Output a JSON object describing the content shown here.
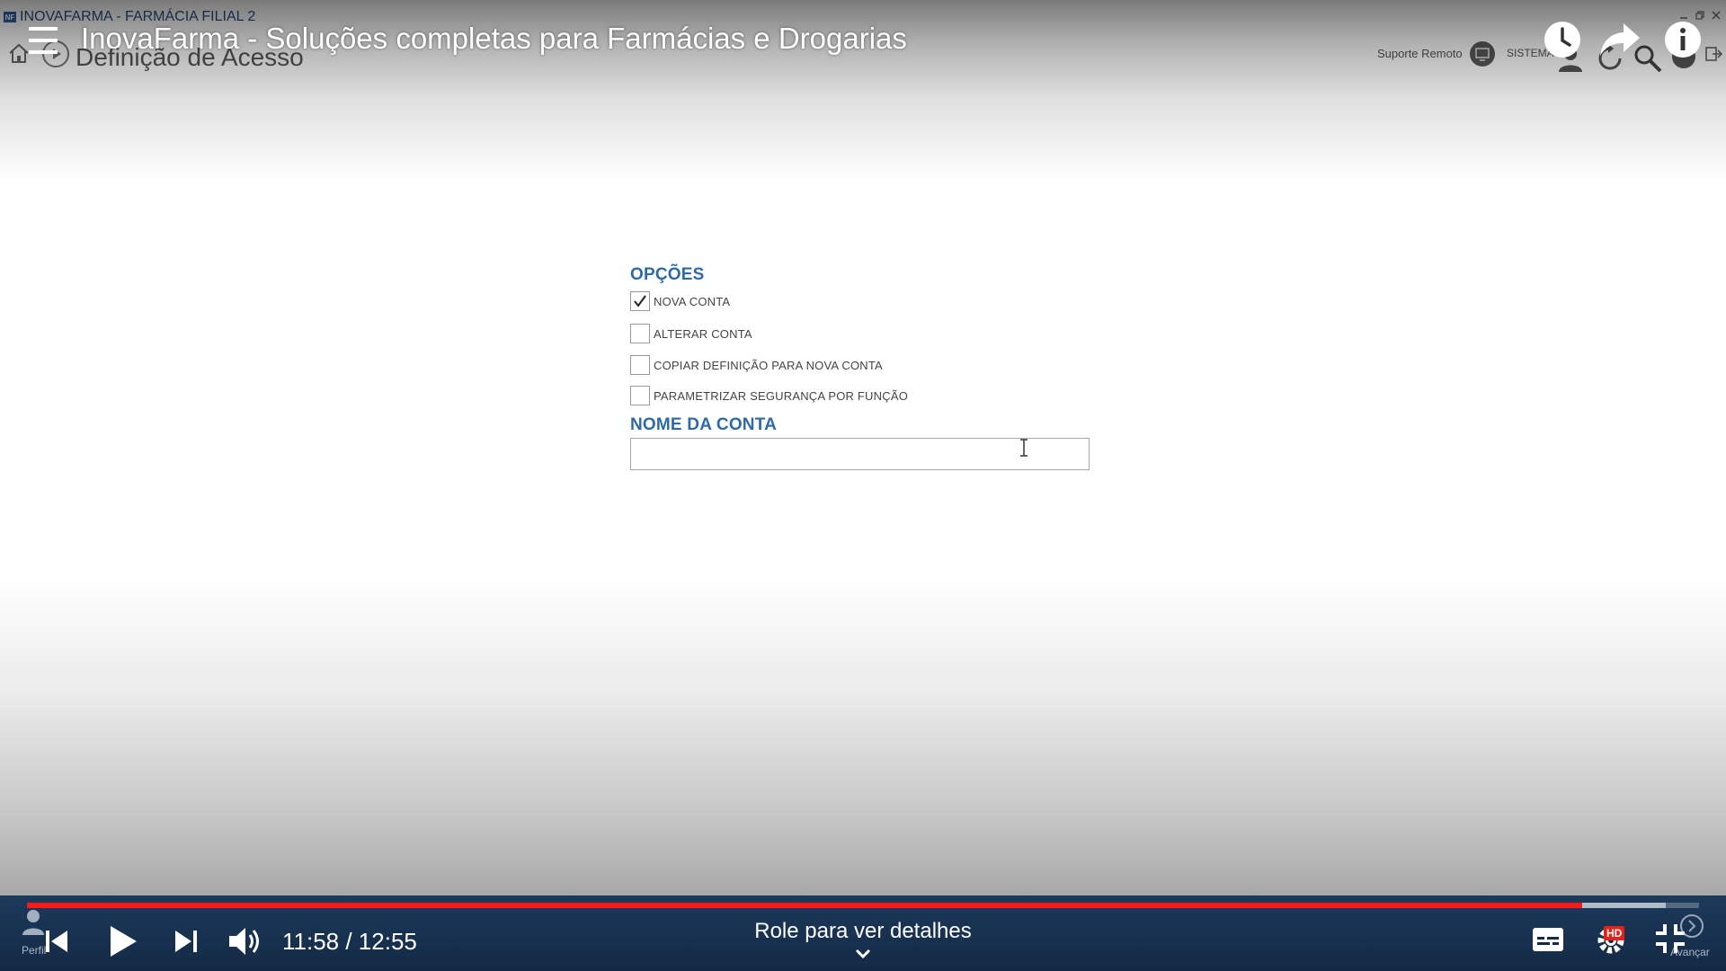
{
  "app": {
    "window_title": "INOVAFARMA - FARMÁCIA FILIAL 2",
    "logo_text": "NF",
    "page_heading": "Definição de Acesso",
    "support_label": "Suporte Remoto",
    "sistema_label": "SISTEMA",
    "footer_left_label": "Perfil",
    "footer_right_label": "Avançar"
  },
  "form": {
    "options_title": "OPÇÕES",
    "options": [
      {
        "label": "NOVA CONTA",
        "checked": true
      },
      {
        "label": "ALTERAR CONTA",
        "checked": false
      },
      {
        "label": "COPIAR DEFINIÇÃO PARA NOVA CONTA",
        "checked": false
      },
      {
        "label": "PARAMETRIZAR SEGURANÇA POR FUNÇÃO",
        "checked": false
      }
    ],
    "account_name_title": "NOME DA CONTA",
    "account_name_value": ""
  },
  "video": {
    "title": "InovaFarma - Soluções completas para Farmácias e Drogarias",
    "time_display": "11:58 / 12:55",
    "scroll_hint": "Role para ver detalhes",
    "hd_badge": "HD",
    "progress_played": 0.93,
    "progress_buffered": 0.98
  },
  "colors": {
    "accent_red": "#ff1a1a",
    "section_title": "#2e6aa8",
    "control_bar": "#1d3a5c"
  }
}
